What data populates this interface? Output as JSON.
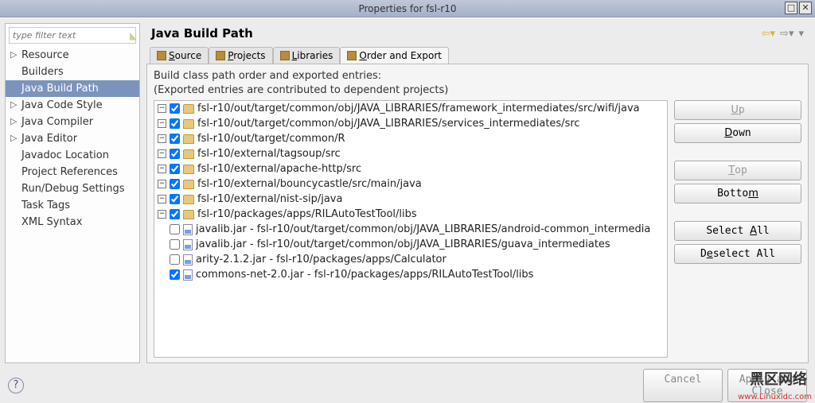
{
  "window": {
    "title": "Properties for fsl-r10"
  },
  "filter": {
    "placeholder": "type filter text"
  },
  "sidebar": {
    "items": [
      {
        "label": "Resource",
        "expandable": true,
        "selected": false
      },
      {
        "label": "Builders",
        "expandable": false,
        "selected": false
      },
      {
        "label": "Java Build Path",
        "expandable": false,
        "selected": true
      },
      {
        "label": "Java Code Style",
        "expandable": true,
        "selected": false
      },
      {
        "label": "Java Compiler",
        "expandable": true,
        "selected": false
      },
      {
        "label": "Java Editor",
        "expandable": true,
        "selected": false
      },
      {
        "label": "Javadoc Location",
        "expandable": false,
        "selected": false
      },
      {
        "label": "Project References",
        "expandable": false,
        "selected": false
      },
      {
        "label": "Run/Debug Settings",
        "expandable": false,
        "selected": false
      },
      {
        "label": "Task Tags",
        "expandable": false,
        "selected": false
      },
      {
        "label": "XML Syntax",
        "expandable": false,
        "selected": false
      }
    ]
  },
  "page": {
    "title": "Java Build Path",
    "tabs": [
      {
        "label": "Source"
      },
      {
        "label": "Projects"
      },
      {
        "label": "Libraries"
      },
      {
        "label": "Order and Export"
      }
    ],
    "desc1": "Build class path order and exported entries:",
    "desc2": "(Exported entries are contributed to dependent projects)"
  },
  "entries": [
    {
      "type": "src",
      "expandable": true,
      "checked": true,
      "label": "fsl-r10/out/target/common/obj/JAVA_LIBRARIES/framework_intermediates/src/wifi/java"
    },
    {
      "type": "src",
      "expandable": true,
      "checked": true,
      "label": "fsl-r10/out/target/common/obj/JAVA_LIBRARIES/services_intermediates/src"
    },
    {
      "type": "src",
      "expandable": true,
      "checked": true,
      "label": "fsl-r10/out/target/common/R"
    },
    {
      "type": "src",
      "expandable": true,
      "checked": true,
      "label": "fsl-r10/external/tagsoup/src"
    },
    {
      "type": "src",
      "expandable": true,
      "checked": true,
      "label": "fsl-r10/external/apache-http/src"
    },
    {
      "type": "src",
      "expandable": true,
      "checked": true,
      "label": "fsl-r10/external/bouncycastle/src/main/java"
    },
    {
      "type": "src",
      "expandable": true,
      "checked": true,
      "label": "fsl-r10/external/nist-sip/java"
    },
    {
      "type": "src",
      "expandable": true,
      "checked": true,
      "label": "fsl-r10/packages/apps/RILAutoTestTool/libs"
    },
    {
      "type": "jar",
      "expandable": false,
      "checked": false,
      "label": "javalib.jar - fsl-r10/out/target/common/obj/JAVA_LIBRARIES/android-common_intermedia"
    },
    {
      "type": "jar",
      "expandable": false,
      "checked": false,
      "label": "javalib.jar - fsl-r10/out/target/common/obj/JAVA_LIBRARIES/guava_intermediates"
    },
    {
      "type": "jar",
      "expandable": false,
      "checked": false,
      "label": "arity-2.1.2.jar - fsl-r10/packages/apps/Calculator"
    },
    {
      "type": "jar",
      "expandable": false,
      "checked": true,
      "label": "commons-net-2.0.jar - fsl-r10/packages/apps/RILAutoTestTool/libs"
    }
  ],
  "buttons": {
    "up": "Up",
    "down": "Down",
    "top": "Top",
    "bottom": "Bottom",
    "selectAll": "Select All",
    "deselectAll": "Deselect All"
  },
  "footer": {
    "cancel": "Cancel",
    "apply": "Apply and Close"
  },
  "watermark": {
    "logo": "黑区网络",
    "url": "www.Linuxidc.com"
  }
}
